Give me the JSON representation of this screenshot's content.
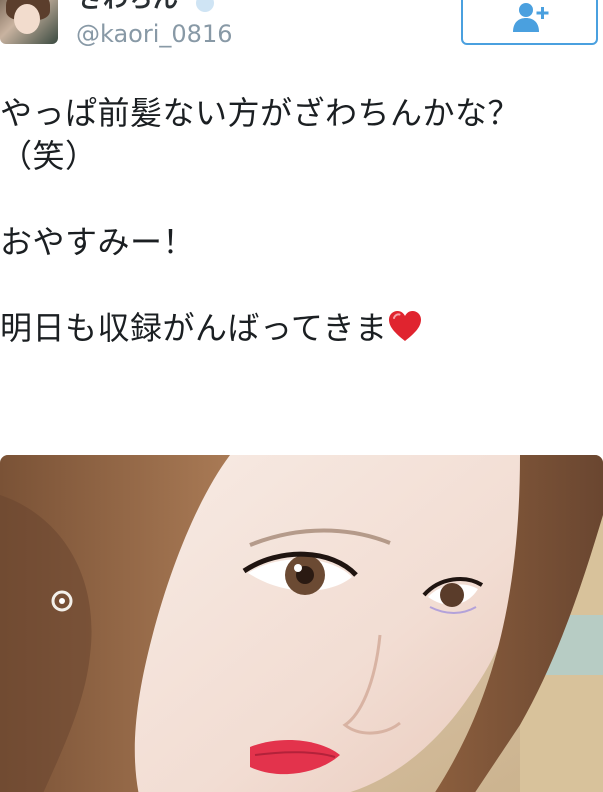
{
  "header": {
    "display_name": "ざわちん",
    "handle": "@kaori_0816"
  },
  "follow_button": {
    "icon": "add-user-icon",
    "color": "#4aa0df"
  },
  "tweet": {
    "lines": [
      "やっぱ前髪ない方がざわちんかな？",
      "（笑）",
      "",
      "おやすみー！",
      "",
      "明日も収録がんばってきま"
    ],
    "trailing_emoji": "heart-icon"
  },
  "media": {
    "type": "photo",
    "subject": "selfie"
  },
  "colors": {
    "name": "#292f33",
    "handle": "#8899a6",
    "text": "#1b1f22",
    "accent": "#4aa0df"
  }
}
